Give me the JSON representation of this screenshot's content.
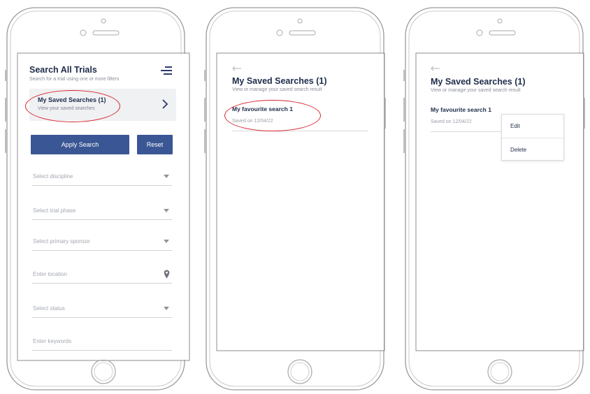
{
  "screen1": {
    "title": "Search All Trials",
    "subtitle": "Search for a trial using one or more filters",
    "saved_card": {
      "title": "My Saved Searches (1)",
      "subtitle": "View your saved searches"
    },
    "apply_label": "Apply Search",
    "reset_label": "Reset",
    "fields": [
      {
        "placeholder": "Select discipline",
        "icon": "dropdown-caret"
      },
      {
        "placeholder": "Select trial phase",
        "icon": "dropdown-caret"
      },
      {
        "placeholder": "Select primary sponsor",
        "icon": "dropdown-caret"
      },
      {
        "placeholder": "Enter location",
        "icon": "location-pin"
      },
      {
        "placeholder": "Select status",
        "icon": "dropdown-caret"
      },
      {
        "placeholder": "Enter keywords",
        "icon": "none"
      }
    ]
  },
  "screen2": {
    "title": "My Saved Searches (1)",
    "subtitle": "View or manage your saved search result",
    "entry": {
      "title": "My favourite search 1",
      "date": "Saved on 12/04/22"
    }
  },
  "screen3": {
    "title": "My Saved Searches (1)",
    "subtitle": "View or manage your saved search result",
    "entry": {
      "title": "My favourite search 1",
      "date": "Saved on 12/04/22"
    },
    "menu": {
      "edit_label": "Edit",
      "delete_label": "Delete"
    }
  },
  "colors": {
    "primary": "#3a5694",
    "highlight_oval": "#d7262d",
    "card_bg": "#f0f1f3"
  }
}
